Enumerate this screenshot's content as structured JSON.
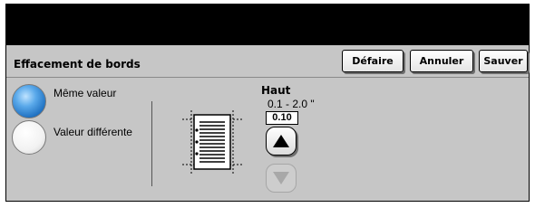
{
  "header": {
    "title": "Effacement de bords",
    "buttons": {
      "undo": "Défaire",
      "cancel": "Annuler",
      "save": "Sauver"
    }
  },
  "options": {
    "same_value": "Même valeur",
    "different_value": "Valeur différente",
    "selected": "same_value"
  },
  "field": {
    "label": "Haut",
    "range": "0.1 -  2.0 \"",
    "value": "0.10"
  },
  "icons": {
    "radio_selected": "radio-selected-icon",
    "radio_unselected": "radio-unselected-icon",
    "document": "page-borders-icon",
    "up": "arrow-up-icon",
    "down": "arrow-down-icon"
  },
  "colors": {
    "radio_selected": "#1e6fc0",
    "panel": "#c6c6c6",
    "topbar": "#000000"
  }
}
